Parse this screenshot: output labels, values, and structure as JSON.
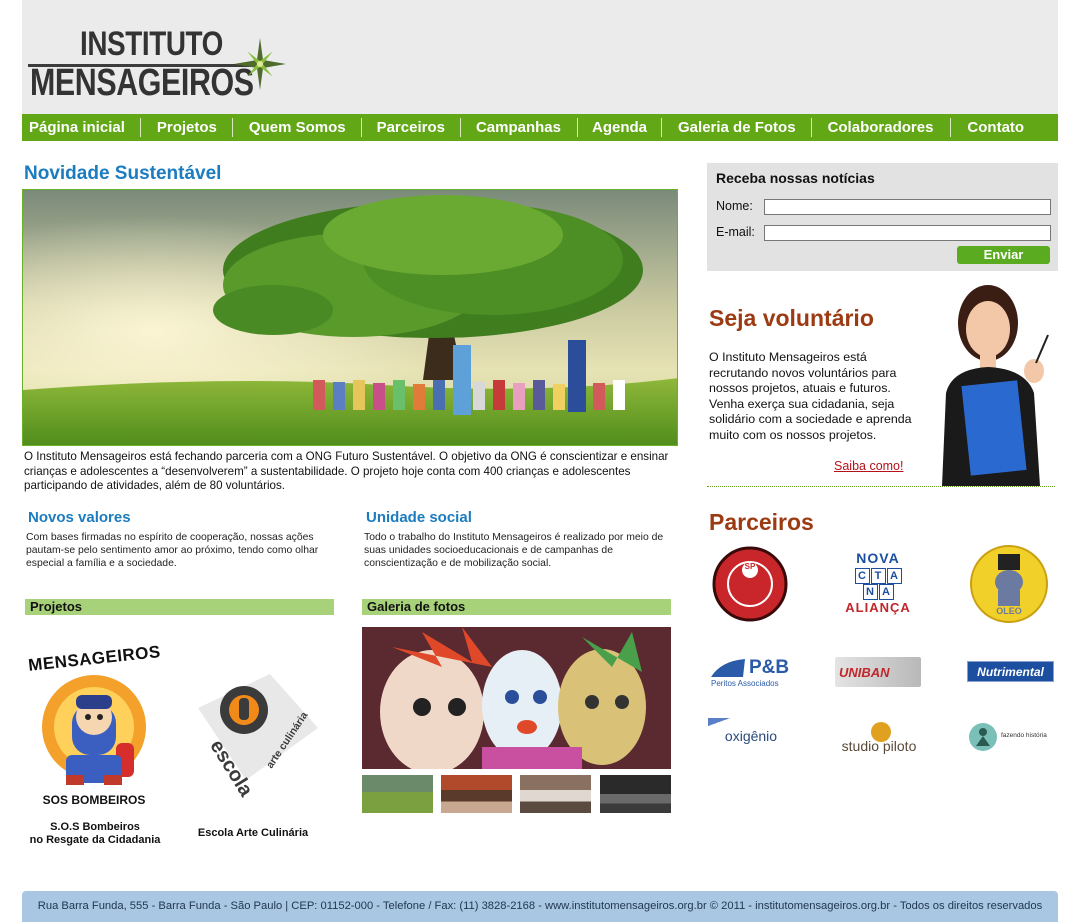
{
  "header": {
    "logo_line1": "INSTITUTO",
    "logo_line2": "MENSAGEIROS"
  },
  "nav": {
    "items": [
      "Página inicial",
      "Projetos",
      "Quem Somos",
      "Parceiros",
      "Campanhas",
      "Agenda",
      "Galeria de Fotos",
      "Colaboradores",
      "Contato"
    ]
  },
  "featured": {
    "title": "Novidade Sustentável",
    "text": "O Instituto Mensageiros está fechando parceria com a ONG Futuro Sustentável. O objetivo da ONG é conscientizar e ensinar crianças e adolescentes a “desenvolverem” a sustentabilidade. O projeto hoje conta com 400 crianças e adolescentes participando de atividades, além de 80 voluntários."
  },
  "novos_valores": {
    "title": "Novos valores",
    "text": "Com bases firmadas no espírito de cooperação, nossas ações pautam-se pelo sentimento amor ao próximo, tendo como olhar especial a família e a sociedade."
  },
  "unidade_social": {
    "title": "Unidade social",
    "text": "Todo o trabalho do Instituto Mensageiros é realizado por meio de suas unidades socioeducacionais e de campanhas de conscientização e de mobilização social."
  },
  "projetos": {
    "title": "Projetos",
    "items": [
      {
        "logo_text": "MENSAGEIROS",
        "logo_subtext": "SOS BOMBEIROS",
        "caption_line1": "S.O.S Bombeiros",
        "caption_line2": "no Resgate da Cidadania"
      },
      {
        "logo_text": "escola",
        "logo_subtext": "arte culinária",
        "caption_line1": "Escola Arte Culinária",
        "caption_line2": ""
      }
    ]
  },
  "galeria": {
    "title": "Galeria de fotos"
  },
  "newsletter": {
    "title": "Receba nossas notícias",
    "name_label": "Nome:",
    "email_label": "E-mail:",
    "name_value": "",
    "email_value": "",
    "submit_label": "Enviar"
  },
  "volunteer": {
    "title": "Seja voluntário",
    "text": "O Instituto Mensageiros está recrutando novos voluntários para nossos projetos, atuais e futuros. Venha exerça sua cidadania, seja solidário com a sociedade e aprenda muito com os nossos projetos.",
    "link": "Saiba como!"
  },
  "partners": {
    "title": "Parceiros",
    "logos": {
      "badge1": "SP",
      "nova": "NOVA",
      "cta_c": "C",
      "cta_t": "T",
      "cta_a": "A",
      "cta_n": "N",
      "cta_a2": "A",
      "alianca": "ALIANÇA",
      "oleo": "OLEO",
      "pb": "P&B",
      "pb_sub": "Peritos Associados",
      "uniban": "UNIBAN",
      "nutrimental": "Nutrimental",
      "oxigenio": "oxigênio",
      "studio": "studio piloto",
      "instituto_small": "fazendo história"
    }
  },
  "footer": {
    "text": "Rua Barra Funda, 555 - Barra Funda - São Paulo | CEP: 01152-000 - Telefone / Fax: (11) 3828-2168 - www.institutomensageiros.org.br  © 2011 - institutomensageiros.org.br - Todos os direitos reservados"
  },
  "colors": {
    "nav_green": "#62a716",
    "title_blue": "#1b7cbf",
    "title_rust": "#9c3a12",
    "bar_green": "#a8d27a",
    "footer_blue": "#a9c6e2"
  }
}
